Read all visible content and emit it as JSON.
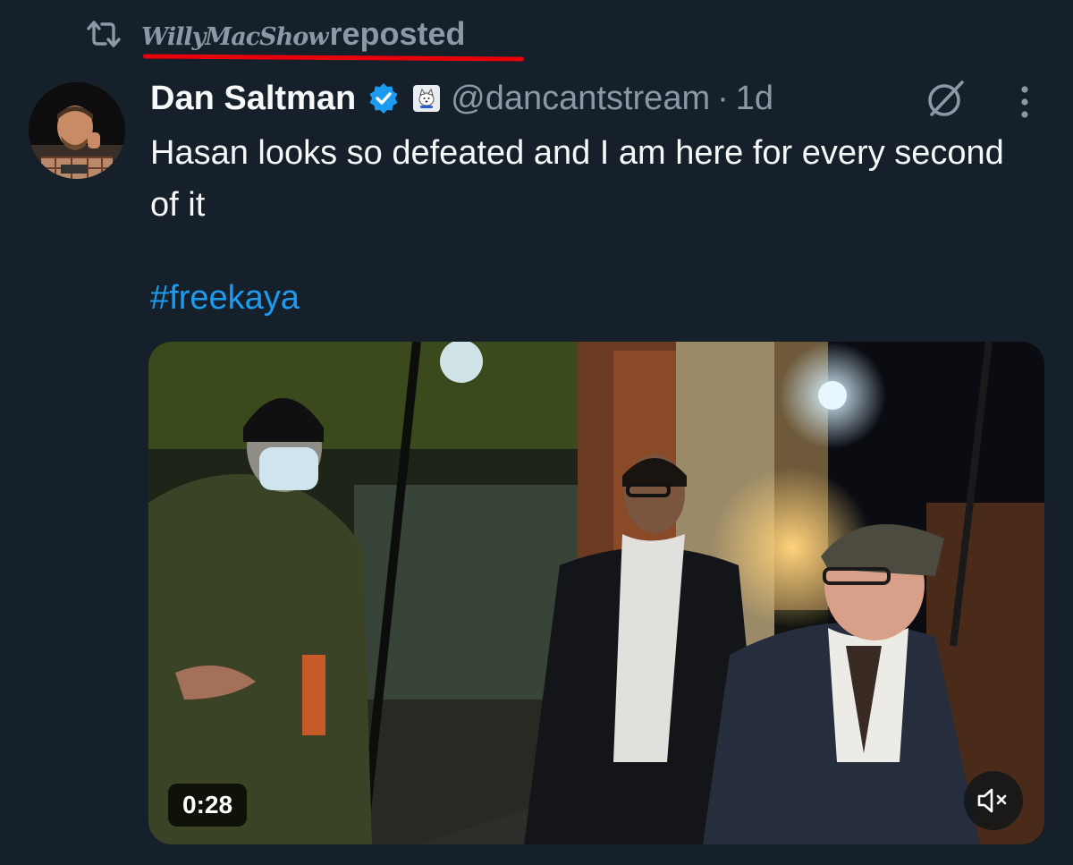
{
  "repost": {
    "icon": "repost-icon",
    "reposter_name": "WillyMacShow",
    "label": "reposted",
    "highlight_color": "#e8000b"
  },
  "tweet": {
    "author_name": "Dan Saltman",
    "verified": true,
    "verified_color": "#1d9bf0",
    "affiliate_badge": "dog-badge-icon",
    "handle": "@dancantstream",
    "separator": "·",
    "time": "1d",
    "text": "Hasan looks so defeated and I am here for every second of it",
    "hashtag": "#freekaya",
    "icons": [
      "grok-icon",
      "more-icon"
    ]
  },
  "media": {
    "type": "video",
    "duration": "0:28",
    "muted": true,
    "mute_icon": "speaker-muted-icon"
  },
  "colors": {
    "background": "#15202b",
    "text": "#f7f9f9",
    "secondary": "#8b98a5",
    "link": "#1d9bf0"
  }
}
